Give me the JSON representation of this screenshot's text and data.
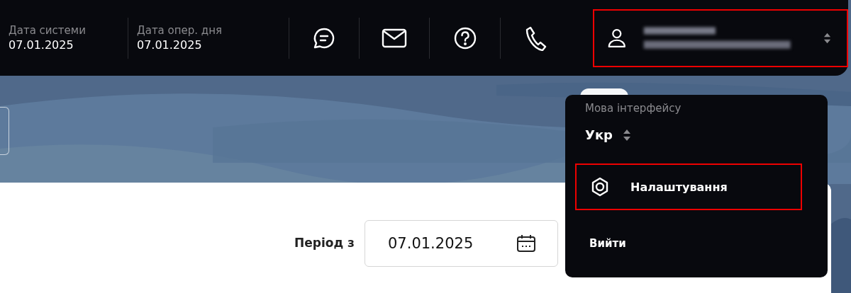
{
  "header": {
    "dates": [
      {
        "label": "Дата системи",
        "value": "07.01.2025"
      },
      {
        "label": "Дата опер. дня",
        "value": "07.01.2025"
      }
    ],
    "icons": [
      {
        "kind": "chat"
      },
      {
        "kind": "mail"
      },
      {
        "kind": "help"
      },
      {
        "kind": "phone"
      }
    ],
    "user": {
      "highlighted": true
    }
  },
  "filter": {
    "label": "Період з",
    "value": "07.01.2025"
  },
  "menu": {
    "language_label": "Мова інтерфейсу",
    "language": "Укр",
    "items": [
      {
        "kind": "settings",
        "label": "Налаштування",
        "highlighted": true
      },
      {
        "kind": "logout",
        "label": "Вийти",
        "highlighted": false
      }
    ]
  }
}
